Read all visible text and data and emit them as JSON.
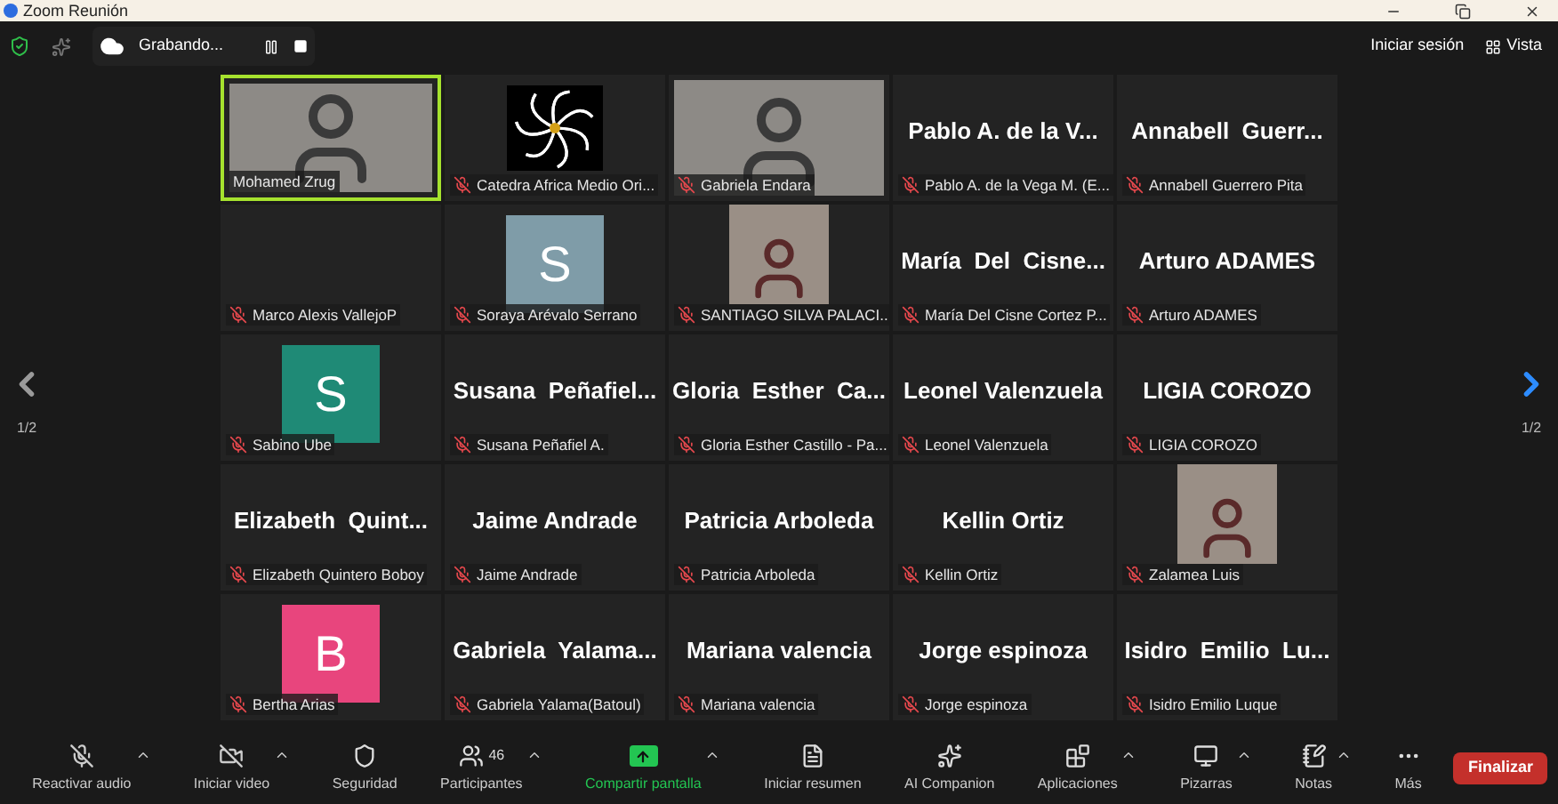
{
  "window": {
    "title": "Zoom Reunión"
  },
  "top_bar": {
    "recording": "Grabando...",
    "sign_in": "Iniciar sesión",
    "view": "Vista"
  },
  "pager": {
    "left": {
      "label": "1/2",
      "enabled": false
    },
    "right": {
      "label": "1/2",
      "enabled": true
    }
  },
  "tiles": [
    {
      "kind": "video",
      "name": "Mohamed Zrug",
      "muted": false,
      "active_speaker": true
    },
    {
      "kind": "logo",
      "name": "Catedra Africa Medio Ori...",
      "muted": true,
      "active_speaker": false
    },
    {
      "kind": "video",
      "name": "Gabriela Endara",
      "muted": true,
      "active_speaker": false
    },
    {
      "kind": "name",
      "display": "Pablo A. de la V...",
      "name": "Pablo A. de la Vega M. (E...",
      "muted": true,
      "active_speaker": false
    },
    {
      "kind": "name",
      "display": "Annabell  Guerr...",
      "name": "Annabell Guerrero Pita",
      "muted": true,
      "active_speaker": false
    },
    {
      "kind": "blank",
      "name": "Marco Alexis VallejoP",
      "muted": true,
      "active_speaker": false
    },
    {
      "kind": "avatar",
      "letter": "S",
      "color": "#7f9ca8",
      "name": "Soraya Arévalo Serrano",
      "muted": true,
      "active_speaker": false
    },
    {
      "kind": "video_small",
      "name": "SANTIAGO SILVA PALACI...",
      "muted": true,
      "active_speaker": false
    },
    {
      "kind": "name",
      "display": "María  Del  Cisne...",
      "name": "María Del Cisne Cortez P...",
      "muted": true,
      "active_speaker": false
    },
    {
      "kind": "name",
      "display": "Arturo ADAMES",
      "name": "Arturo ADAMES",
      "muted": true,
      "active_speaker": false
    },
    {
      "kind": "avatar",
      "letter": "S",
      "color": "#1f8a76",
      "name": "Sabino Ube",
      "muted": true,
      "active_speaker": false
    },
    {
      "kind": "name",
      "display": "Susana  Peñafiel...",
      "name": "Susana Peñafiel A.",
      "muted": true,
      "active_speaker": false
    },
    {
      "kind": "name",
      "display": "Gloria  Esther  Ca...",
      "name": "Gloria Esther Castillo - Pa...",
      "muted": true,
      "active_speaker": false
    },
    {
      "kind": "name",
      "display": "Leonel Valenzuela",
      "name": "Leonel Valenzuela",
      "muted": true,
      "active_speaker": false
    },
    {
      "kind": "name",
      "display": "LIGIA COROZO",
      "name": "LIGIA COROZO",
      "muted": true,
      "active_speaker": false
    },
    {
      "kind": "name",
      "display": "Elizabeth  Quint...",
      "name": "Elizabeth Quintero Boboy",
      "muted": true,
      "active_speaker": false
    },
    {
      "kind": "name",
      "display": "Jaime Andrade",
      "name": "Jaime Andrade",
      "muted": true,
      "active_speaker": false
    },
    {
      "kind": "name",
      "display": "Patricia Arboleda",
      "name": "Patricia Arboleda",
      "muted": true,
      "active_speaker": false
    },
    {
      "kind": "name",
      "display": "Kellin Ortiz",
      "name": "Kellin Ortiz",
      "muted": true,
      "active_speaker": false
    },
    {
      "kind": "video_small",
      "name": "Zalamea Luis",
      "muted": true,
      "active_speaker": false
    },
    {
      "kind": "avatar",
      "letter": "B",
      "color": "#e8457d",
      "name": "Bertha Arias",
      "muted": true,
      "active_speaker": false
    },
    {
      "kind": "name",
      "display": "Gabriela  Yalama...",
      "name": "Gabriela Yalama(Batoul)",
      "muted": true,
      "active_speaker": false
    },
    {
      "kind": "name",
      "display": "Mariana valencia",
      "name": "Mariana valencia",
      "muted": true,
      "active_speaker": false
    },
    {
      "kind": "name",
      "display": "Jorge espinoza",
      "name": "Jorge espinoza",
      "muted": true,
      "active_speaker": false
    },
    {
      "kind": "name",
      "display": "Isidro  Emilio  Lu...",
      "name": "Isidro Emilio Luque",
      "muted": true,
      "active_speaker": false
    }
  ],
  "toolbar": {
    "items": [
      {
        "label": "Reactivar audio",
        "menu": true,
        "kind": "plain"
      },
      {
        "label": "Iniciar video",
        "menu": true,
        "kind": "plain"
      },
      {
        "label": "Seguridad",
        "menu": false,
        "kind": "plain"
      },
      {
        "label": "Participantes",
        "count": "46",
        "menu": true,
        "kind": "plain"
      },
      {
        "label": "Compartir pantalla",
        "menu": true,
        "kind": "share"
      },
      {
        "label": "Iniciar resumen",
        "menu": false,
        "kind": "plain"
      },
      {
        "label": "AI Companion",
        "menu": false,
        "kind": "plain"
      },
      {
        "label": "Aplicaciones",
        "menu": true,
        "kind": "plain"
      },
      {
        "label": "Pizarras",
        "menu": true,
        "kind": "plain"
      },
      {
        "label": "Notas",
        "menu": true,
        "kind": "plain"
      },
      {
        "label": "Más",
        "menu": false,
        "kind": "plain"
      }
    ],
    "end": "Finalizar"
  }
}
